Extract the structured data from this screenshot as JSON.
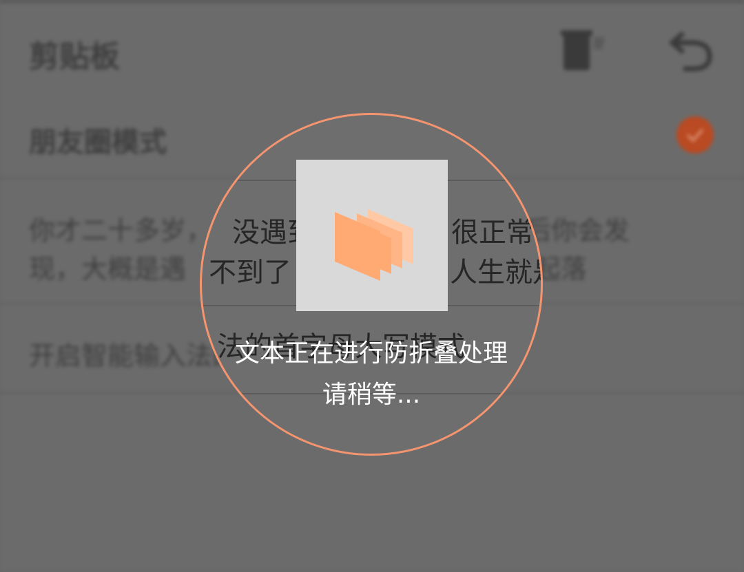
{
  "header": {
    "title": "剪贴板"
  },
  "mode_row": {
    "label": "朋友圈模式",
    "checked": true,
    "accent_color": "#b94a22"
  },
  "text_item": {
    "line1_left": "你才二十多岁，",
    "line1_mid": "没遇到",
    "line1_right": "很正常，往后你会发",
    "line2_left": "现，大概是遇",
    "line2_mid": "不到了",
    "line2_right": "人生就是这样起起落"
  },
  "switch_row": {
    "label": "开启智能输入法的首字母大写模式",
    "label_visible": "法的首字母大写模式"
  },
  "overlay": {
    "processing_line1": "文本正在进行防折叠处理",
    "processing_line2": "请稍等...",
    "ring_color": "#f49570",
    "icon_color": "#ffaa73"
  }
}
